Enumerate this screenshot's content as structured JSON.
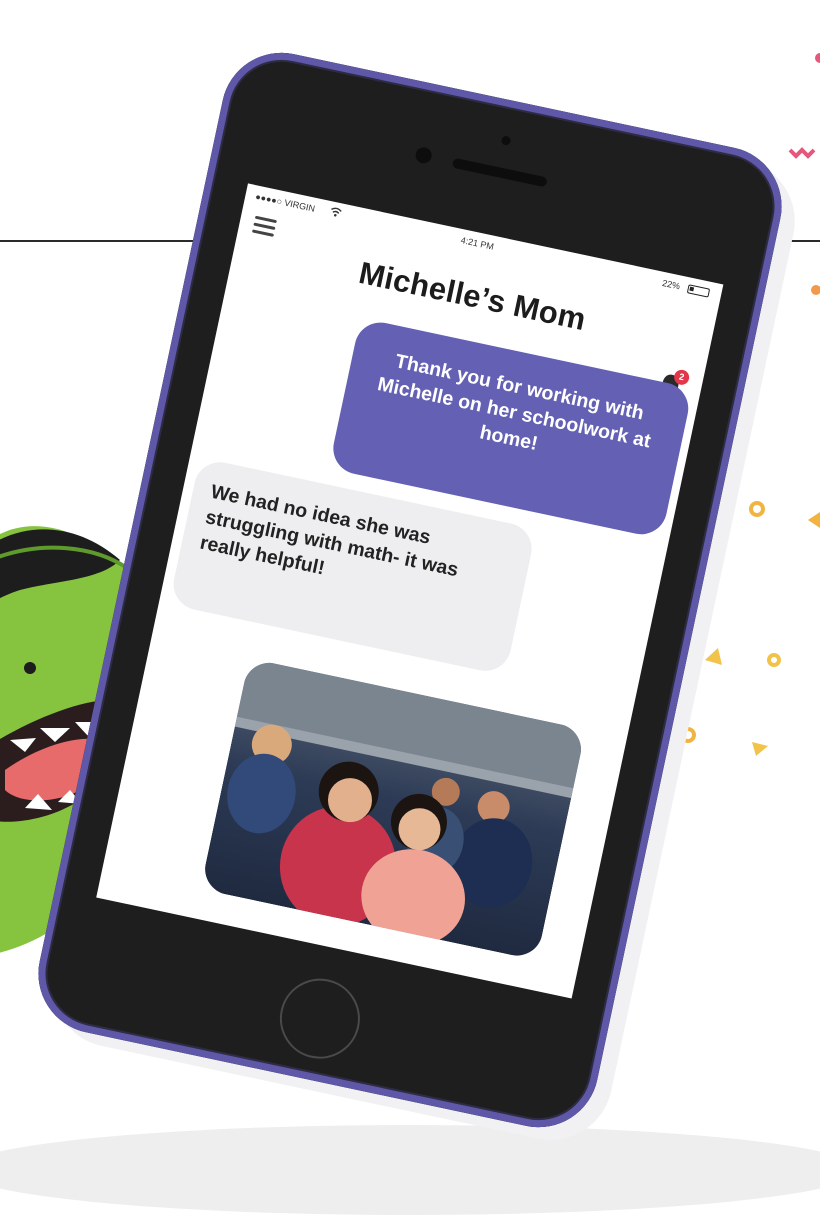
{
  "status_bar": {
    "carrier": "●●●●○ VIRGIN",
    "time": "4:21 PM",
    "battery": "22%"
  },
  "header": {
    "title": "Michelle’s Mom",
    "notification_count": "2"
  },
  "messages": [
    {
      "type": "sent",
      "text": "Thank you for working with Michelle on her schoolwork at home!"
    },
    {
      "type": "received",
      "text": "We had no idea she was struggling with math- it was really helpful!"
    }
  ],
  "colors": {
    "accent": "#6461b4",
    "phone_body": "#1e1e1f",
    "phone_edge": "#5f58a8",
    "received_bubble": "#eeeef0",
    "badge": "#e2364a",
    "monster_green": "#86c440"
  },
  "icons": {
    "menu": "hamburger-menu-icon",
    "bell": "bell-icon",
    "wifi": "wifi-icon",
    "battery": "battery-icon"
  }
}
